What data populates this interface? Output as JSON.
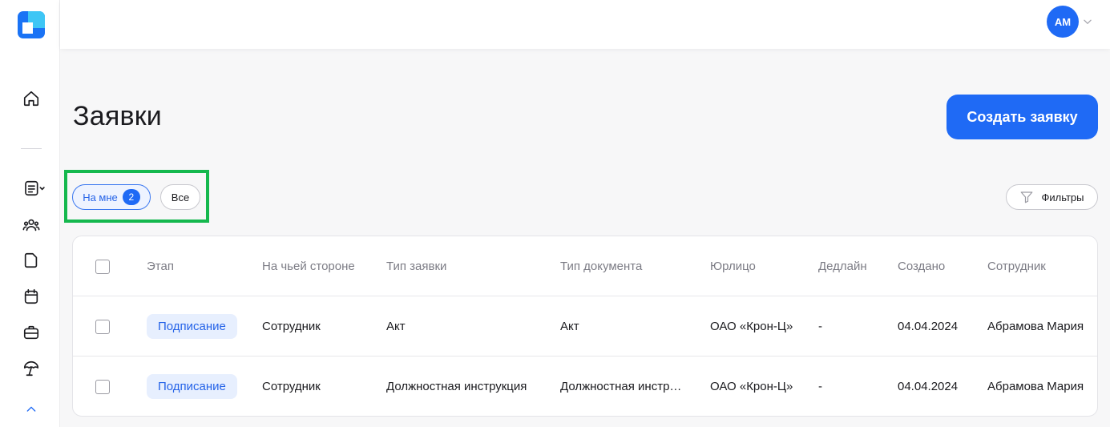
{
  "header": {
    "avatar_initials": "АМ"
  },
  "page": {
    "title": "Заявки",
    "create_button": "Создать заявку"
  },
  "filters": {
    "tabs": [
      {
        "label": "На мне",
        "count": "2",
        "active": true
      },
      {
        "label": "Все",
        "active": false
      }
    ],
    "filters_button": "Фильтры"
  },
  "sidebar": {
    "icons": [
      "home-icon",
      "document-list-icon",
      "users-icon",
      "file-icon",
      "calendar-icon",
      "briefcase-icon",
      "umbrella-icon",
      "chevron-up-icon"
    ]
  },
  "table": {
    "columns": [
      "Этап",
      "На чьей стороне",
      "Тип заявки",
      "Тип документа",
      "Юрлицо",
      "Дедлайн",
      "Создано",
      "Сотрудник"
    ],
    "rows": [
      {
        "stage": "Подписание",
        "side": "Сотрудник",
        "request_type": "Акт",
        "doc_type": "Акт",
        "entity": "ОАО «Крон-Ц»",
        "deadline": "-",
        "created": "04.04.2024",
        "employee": "Абрамова Мария"
      },
      {
        "stage": "Подписание",
        "side": "Сотрудник",
        "request_type": "Должностная инструкция",
        "doc_type": "Должностная инстр…",
        "entity": "ОАО «Крон-Ц»",
        "deadline": "-",
        "created": "04.04.2024",
        "employee": "Абрамова Мария"
      }
    ]
  },
  "colors": {
    "accent": "#1f6af5",
    "highlight": "#15b84e",
    "stage_bg": "#e7effe"
  }
}
